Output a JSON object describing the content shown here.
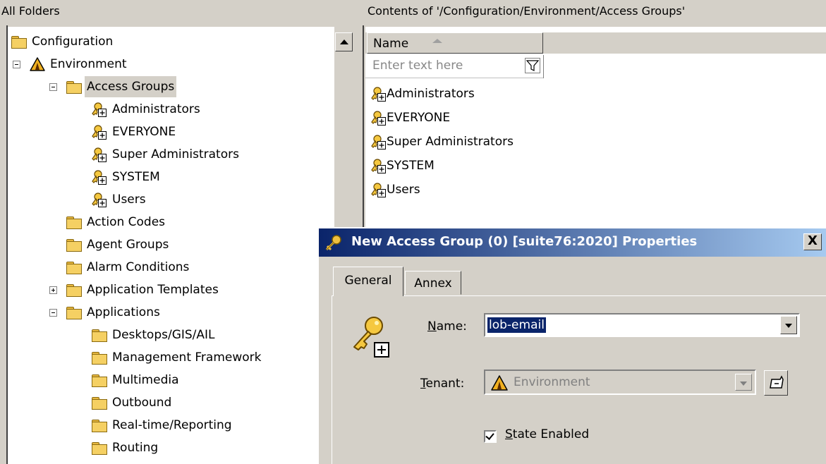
{
  "left_pane": {
    "header": "All Folders",
    "tree": [
      {
        "label": "Configuration",
        "icon": "folder-icon"
      },
      {
        "label": "Environment",
        "icon": "warning-icon",
        "expander": "minus"
      },
      {
        "label": "Access Groups",
        "icon": "folder-open-icon",
        "expander": "minus",
        "selected": true
      },
      {
        "label": "Administrators",
        "icon": "access-group-icon"
      },
      {
        "label": "EVERYONE",
        "icon": "access-group-icon"
      },
      {
        "label": "Super Administrators",
        "icon": "access-group-icon"
      },
      {
        "label": "SYSTEM",
        "icon": "access-group-icon"
      },
      {
        "label": "Users",
        "icon": "access-group-icon"
      },
      {
        "label": "Action Codes",
        "icon": "folder-icon"
      },
      {
        "label": "Agent Groups",
        "icon": "folder-icon"
      },
      {
        "label": "Alarm Conditions",
        "icon": "folder-icon"
      },
      {
        "label": "Application Templates",
        "icon": "folder-icon",
        "expander": "plus"
      },
      {
        "label": "Applications",
        "icon": "folder-icon",
        "expander": "minus"
      },
      {
        "label": "Desktops/GIS/AIL",
        "icon": "folder-icon"
      },
      {
        "label": "Management Framework",
        "icon": "folder-icon"
      },
      {
        "label": "Multimedia",
        "icon": "folder-icon"
      },
      {
        "label": "Outbound",
        "icon": "folder-icon"
      },
      {
        "label": "Real-time/Reporting",
        "icon": "folder-icon"
      },
      {
        "label": "Routing",
        "icon": "folder-icon"
      }
    ]
  },
  "right_pane": {
    "header": "Contents of '/Configuration/Environment/Access Groups'",
    "column_name": "Name",
    "filter_placeholder": "Enter text here",
    "items": [
      "Administrators",
      "EVERYONE",
      "Super Administrators",
      "SYSTEM",
      "Users"
    ]
  },
  "dialog": {
    "title": "New Access Group (0) [suite76:2020] Properties",
    "close_glyph": "X",
    "tabs": [
      "General",
      "Annex"
    ],
    "active_tab": "General",
    "name_label": "Name:",
    "name_value": "lob-email",
    "tenant_label": "Tenant:",
    "tenant_value": "Environment",
    "state_label": "State Enabled",
    "state_checked": true
  }
}
